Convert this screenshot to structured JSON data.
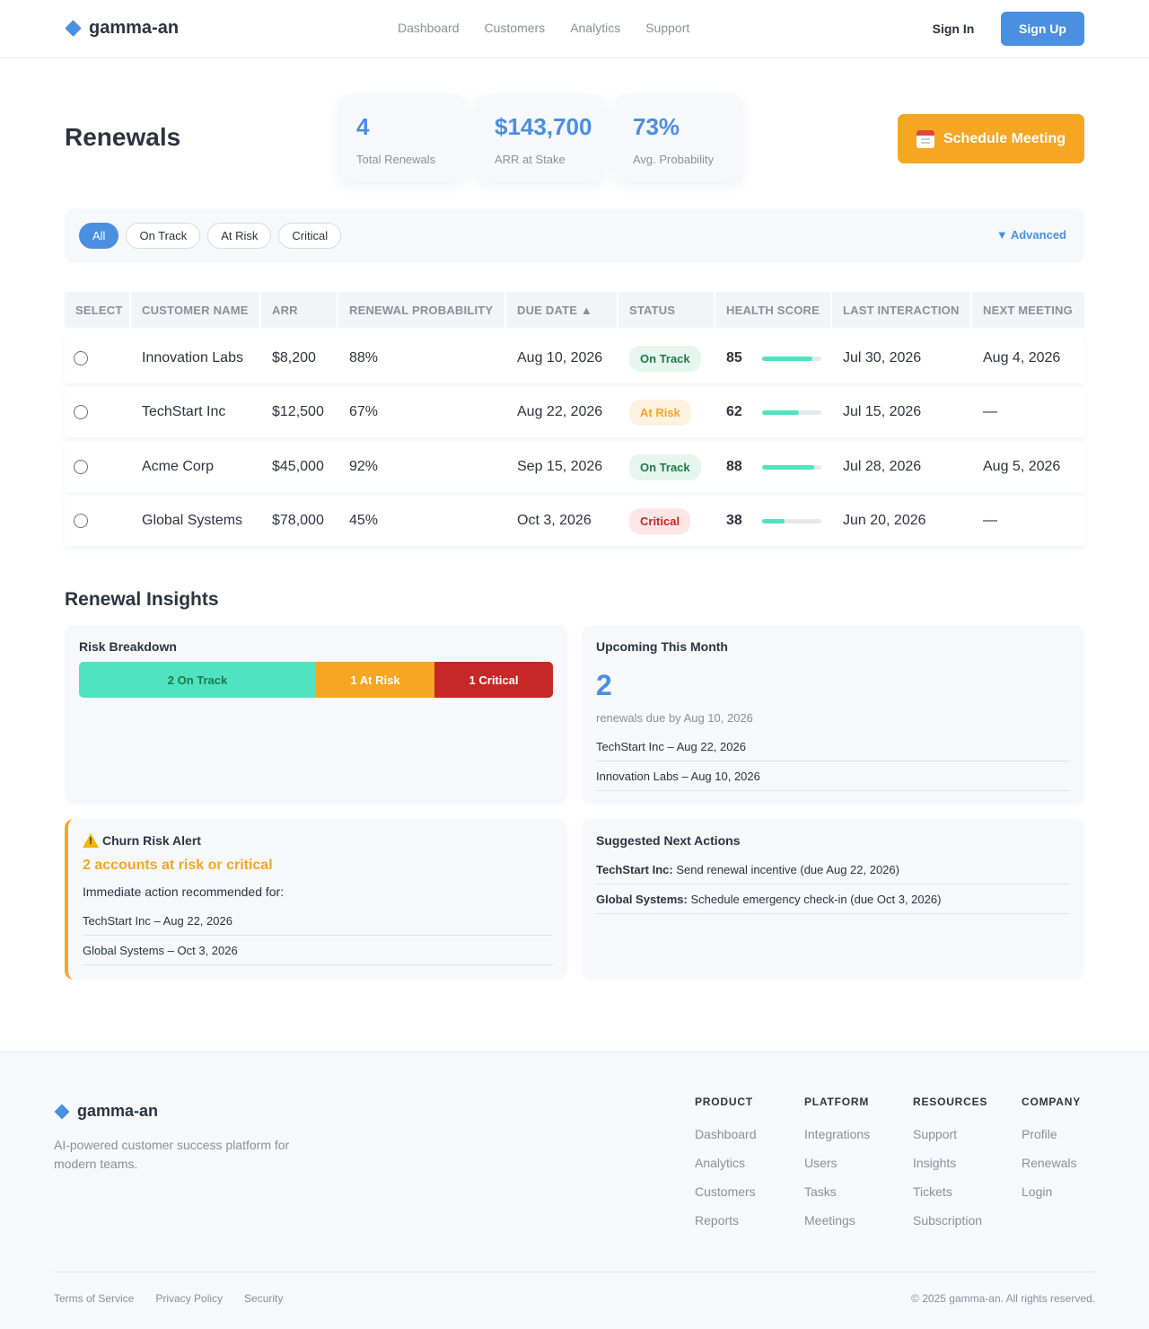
{
  "brand": {
    "name": "gamma-an"
  },
  "nav": {
    "links": [
      "Dashboard",
      "Customers",
      "Analytics",
      "Support"
    ],
    "sign_in": "Sign In",
    "sign_up": "Sign Up"
  },
  "header": {
    "title": "Renewals",
    "stats": [
      {
        "value": "4",
        "label": "Total Renewals"
      },
      {
        "value": "$143,700",
        "label": "ARR at Stake"
      },
      {
        "value": "73%",
        "label": "Avg. Probability"
      }
    ],
    "schedule_button": "Schedule Meeting",
    "schedule_icon": "calendar-icon"
  },
  "filters": {
    "pills": [
      "All",
      "On Track",
      "At Risk",
      "Critical"
    ],
    "active": "All",
    "advanced": "▼ Advanced"
  },
  "table": {
    "columns": [
      "SELECT",
      "CUSTOMER NAME",
      "ARR",
      "RENEWAL PROBABILITY",
      "DUE DATE ▲",
      "STATUS",
      "HEALTH SCORE",
      "LAST INTERACTION",
      "NEXT MEETING"
    ],
    "rows": [
      {
        "name": "Innovation Labs",
        "arr": "$8,200",
        "prob": "88%",
        "due": "Aug 10, 2026",
        "status": "On Track",
        "status_kind": "ontrack",
        "health": "85",
        "health_level": 0.85,
        "last": "Jul 30, 2026",
        "next": "Aug 4, 2026"
      },
      {
        "name": "TechStart Inc",
        "arr": "$12,500",
        "prob": "67%",
        "due": "Aug 22, 2026",
        "status": "At Risk",
        "status_kind": "atrisk",
        "health": "62",
        "health_level": 0.62,
        "last": "Jul 15, 2026",
        "next": "—"
      },
      {
        "name": "Acme Corp",
        "arr": "$45,000",
        "prob": "92%",
        "due": "Sep 15, 2026",
        "status": "On Track",
        "status_kind": "ontrack",
        "health": "88",
        "health_level": 0.88,
        "last": "Jul 28, 2026",
        "next": "Aug 5, 2026"
      },
      {
        "name": "Global Systems",
        "arr": "$78,000",
        "prob": "45%",
        "due": "Oct 3, 2026",
        "status": "Critical",
        "status_kind": "critical",
        "health": "38",
        "health_level": 0.38,
        "last": "Jun 20, 2026",
        "next": "—"
      }
    ]
  },
  "insights": {
    "title": "Renewal Insights",
    "risk": {
      "title": "Risk Breakdown",
      "segments": [
        {
          "label": "2 On Track",
          "count": 2
        },
        {
          "label": "1 At Risk",
          "count": 1
        },
        {
          "label": "1 Critical",
          "count": 1
        }
      ]
    },
    "upcoming": {
      "title": "Upcoming This Month",
      "count": "2",
      "subtitle": "renewals due by Aug 10, 2026",
      "items": [
        "TechStart Inc – Aug 22, 2026",
        "Innovation Labs – Aug 10, 2026"
      ]
    },
    "churn": {
      "title": "Churn Risk Alert",
      "headline": "2 accounts at risk or critical",
      "text": "Immediate action recommended for:",
      "items": [
        "TechStart Inc – Aug 22, 2026",
        "Global Systems – Oct 3, 2026"
      ]
    },
    "actions": {
      "title": "Suggested Next Actions",
      "items": [
        {
          "name": "TechStart Inc:",
          "text": "Send renewal incentive (due Aug 22, 2026)"
        },
        {
          "name": "Global Systems:",
          "text": "Schedule emergency check-in (due Oct 3, 2026)"
        }
      ]
    }
  },
  "footer": {
    "brand": "gamma-an",
    "tagline": "AI-powered customer success platform for modern teams.",
    "columns": [
      {
        "head": "PRODUCT",
        "links": [
          "Dashboard",
          "Analytics",
          "Customers",
          "Reports"
        ]
      },
      {
        "head": "PLATFORM",
        "links": [
          "Integrations",
          "Users",
          "Tasks",
          "Meetings"
        ]
      },
      {
        "head": "RESOURCES",
        "links": [
          "Support",
          "Insights",
          "Tickets",
          "Subscription"
        ]
      },
      {
        "head": "COMPANY",
        "links": [
          "Profile",
          "Renewals",
          "Login"
        ]
      }
    ],
    "legal": [
      "Terms of Service",
      "Privacy Policy",
      "Security"
    ],
    "copyright": "© 2025 gamma-an. All rights reserved."
  },
  "colors": {
    "accent": "#4a8fe0",
    "warning": "#f5a623",
    "critical": "#c62828",
    "ontrack": "#4fe3c1"
  }
}
